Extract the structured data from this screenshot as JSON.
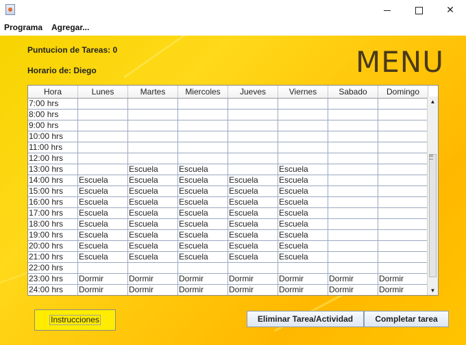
{
  "window": {
    "app_icon": "java-cup-icon"
  },
  "menubar": {
    "items": [
      "Programa",
      "Agregar..."
    ]
  },
  "header": {
    "score_label": "Puntucion de Tareas: 0",
    "schedule_label": "Horario de: Diego",
    "title": "MENU"
  },
  "table": {
    "columns": [
      "Hora",
      "Lunes",
      "Martes",
      "Miercoles",
      "Jueves",
      "Viernes",
      "Sabado",
      "Domingo"
    ],
    "rows": [
      [
        "7:00 hrs",
        "",
        "",
        "",
        "",
        "",
        "",
        ""
      ],
      [
        "8:00 hrs",
        "",
        "",
        "",
        "",
        "",
        "",
        ""
      ],
      [
        "9:00 hrs",
        "",
        "",
        "",
        "",
        "",
        "",
        ""
      ],
      [
        "10:00 hrs",
        "",
        "",
        "",
        "",
        "",
        "",
        ""
      ],
      [
        "11:00 hrs",
        "",
        "",
        "",
        "",
        "",
        "",
        ""
      ],
      [
        "12:00 hrs",
        "",
        "",
        "",
        "",
        "",
        "",
        ""
      ],
      [
        "13:00 hrs",
        "",
        "Escuela",
        "Escuela",
        "",
        "Escuela",
        "",
        ""
      ],
      [
        "14:00 hrs",
        "Escuela",
        "Escuela",
        "Escuela",
        "Escuela",
        "Escuela",
        "",
        ""
      ],
      [
        "15:00 hrs",
        "Escuela",
        "Escuela",
        "Escuela",
        "Escuela",
        "Escuela",
        "",
        ""
      ],
      [
        "16:00 hrs",
        "Escuela",
        "Escuela",
        "Escuela",
        "Escuela",
        "Escuela",
        "",
        ""
      ],
      [
        "17:00 hrs",
        "Escuela",
        "Escuela",
        "Escuela",
        "Escuela",
        "Escuela",
        "",
        ""
      ],
      [
        "18:00 hrs",
        "Escuela",
        "Escuela",
        "Escuela",
        "Escuela",
        "Escuela",
        "",
        ""
      ],
      [
        "19:00 hrs",
        "Escuela",
        "Escuela",
        "Escuela",
        "Escuela",
        "Escuela",
        "",
        ""
      ],
      [
        "20:00 hrs",
        "Escuela",
        "Escuela",
        "Escuela",
        "Escuela",
        "Escuela",
        "",
        ""
      ],
      [
        "21:00 hrs",
        "Escuela",
        "Escuela",
        "Escuela",
        "Escuela",
        "Escuela",
        "",
        ""
      ],
      [
        "22:00 hrs",
        "",
        "",
        "",
        "",
        "",
        "",
        ""
      ],
      [
        "23:00 hrs",
        "Dormir",
        "Dormir",
        "Dormir",
        "Dormir",
        "Dormir",
        "Dormir",
        "Dormir"
      ],
      [
        "24:00 hrs",
        "Dormir",
        "Dormir",
        "Dormir",
        "Dormir",
        "Dormir",
        "Dormir",
        "Dormir"
      ]
    ]
  },
  "buttons": {
    "instructions": "Instrucciones",
    "delete_task": "Eliminar Tarea/Actividad",
    "complete_task": "Completar tarea"
  },
  "colors": {
    "panel_bg": "#ffc60a",
    "instructions_bg": "#ffec00",
    "title": "#4a3a1a"
  }
}
